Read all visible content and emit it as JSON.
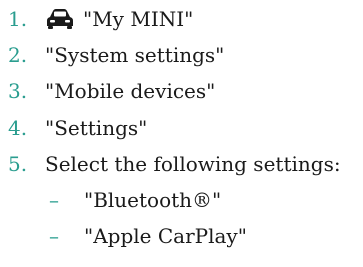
{
  "accent_color": "#2a9d8f",
  "text_color": "#1a1a1a",
  "steps": [
    {
      "number": "1.",
      "icon": "car-icon",
      "text": "\"My MINI\""
    },
    {
      "number": "2.",
      "text": "\"System settings\""
    },
    {
      "number": "3.",
      "text": "\"Mobile devices\""
    },
    {
      "number": "4.",
      "text": "\"Settings\""
    },
    {
      "number": "5.",
      "text": "Select the following settings:"
    }
  ],
  "sub_items": [
    {
      "bullet": "–",
      "text": "\"Bluetooth®\""
    },
    {
      "bullet": "–",
      "text": "\"Apple CarPlay\""
    }
  ]
}
